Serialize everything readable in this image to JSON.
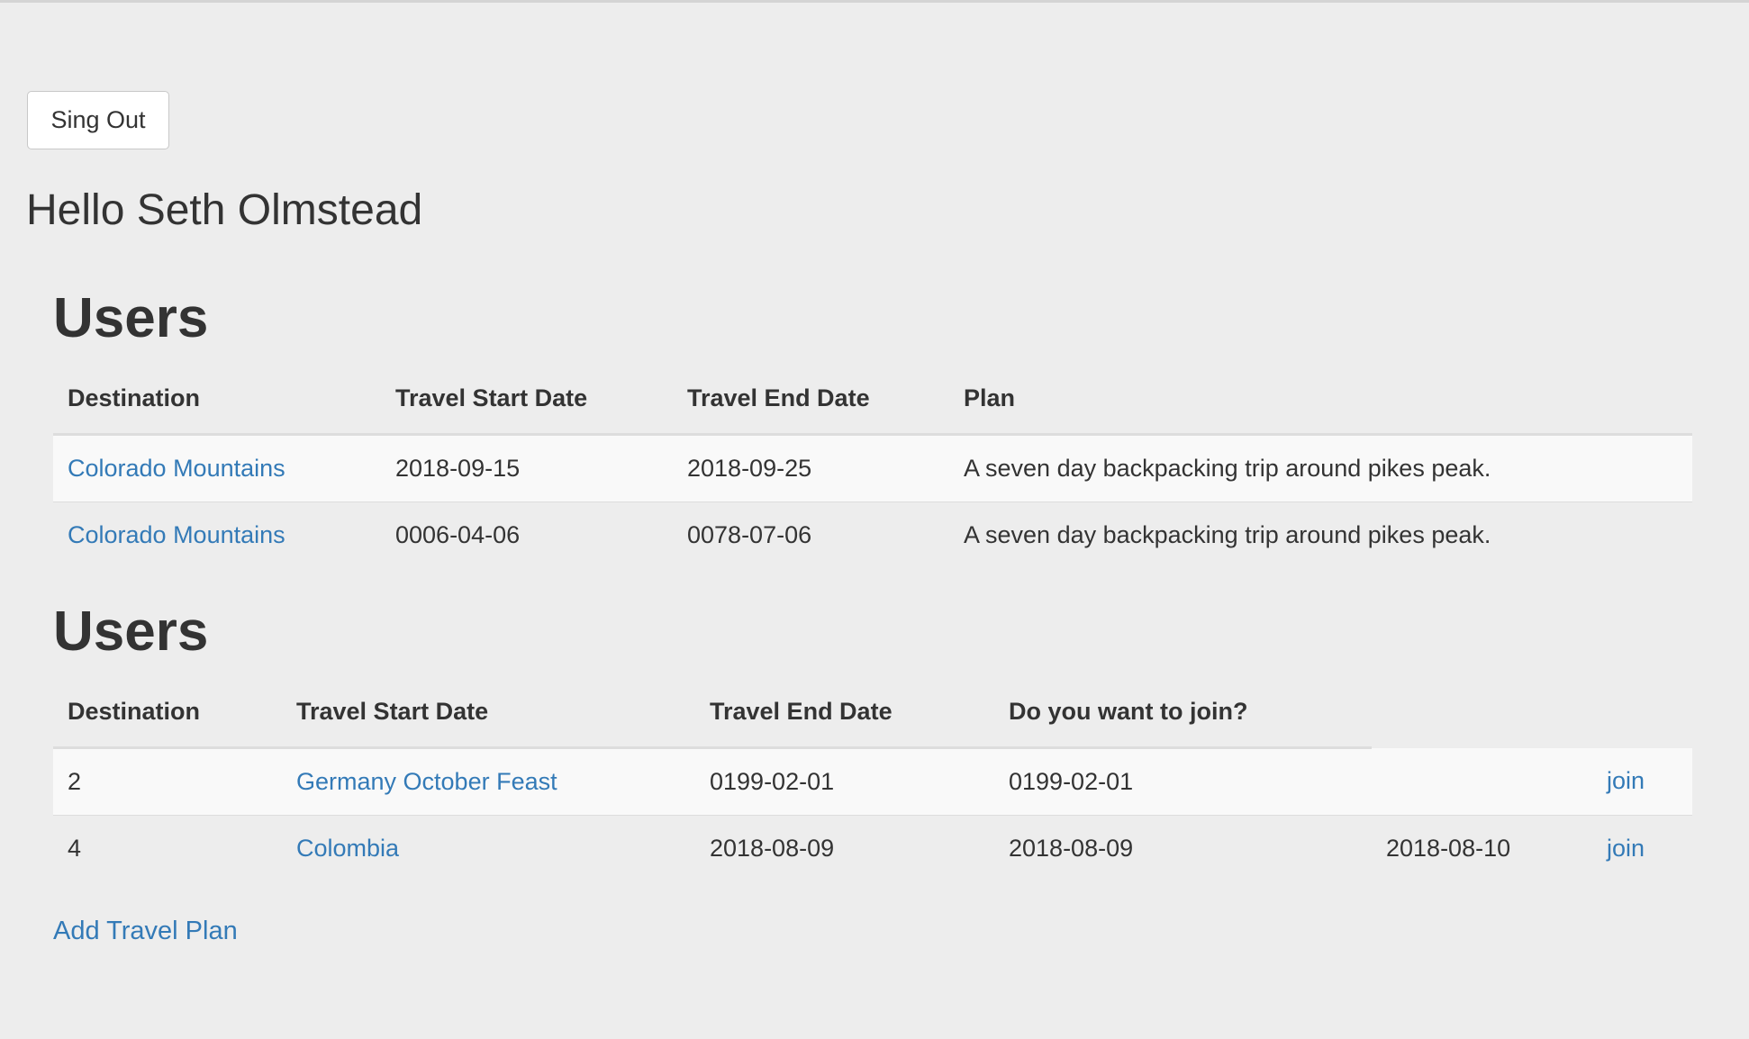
{
  "header": {
    "signout_label": "Sing Out",
    "greeting": "Hello Seth Olmstead"
  },
  "my_plans": {
    "title": "Users",
    "columns": [
      "Destination",
      "Travel Start Date",
      "Travel End Date",
      "Plan"
    ],
    "rows": [
      {
        "destination": "Colorado Mountains",
        "start": "2018-09-15",
        "end": "2018-09-25",
        "plan": "A seven day backpacking trip around pikes peak."
      },
      {
        "destination": "Colorado Mountains",
        "start": "0006-04-06",
        "end": "0078-07-06",
        "plan": "A seven day backpacking trip around pikes peak."
      }
    ]
  },
  "other_plans": {
    "title": "Users",
    "columns": [
      "Destination",
      "Travel Start Date",
      "Travel End Date",
      "Do you want to join?"
    ],
    "rows": [
      {
        "id": "2",
        "destination": "Germany October Feast",
        "start": "0199-02-01",
        "end": "0199-02-01",
        "extra": "",
        "action": "join"
      },
      {
        "id": "4",
        "destination": "Colombia",
        "start": "2018-08-09",
        "end": "2018-08-09",
        "extra": "2018-08-10",
        "action": "join"
      }
    ]
  },
  "footer": {
    "add_plan_label": "Add Travel Plan"
  },
  "colors": {
    "link": "#337ab7",
    "background": "#ededed",
    "text": "#333333"
  }
}
